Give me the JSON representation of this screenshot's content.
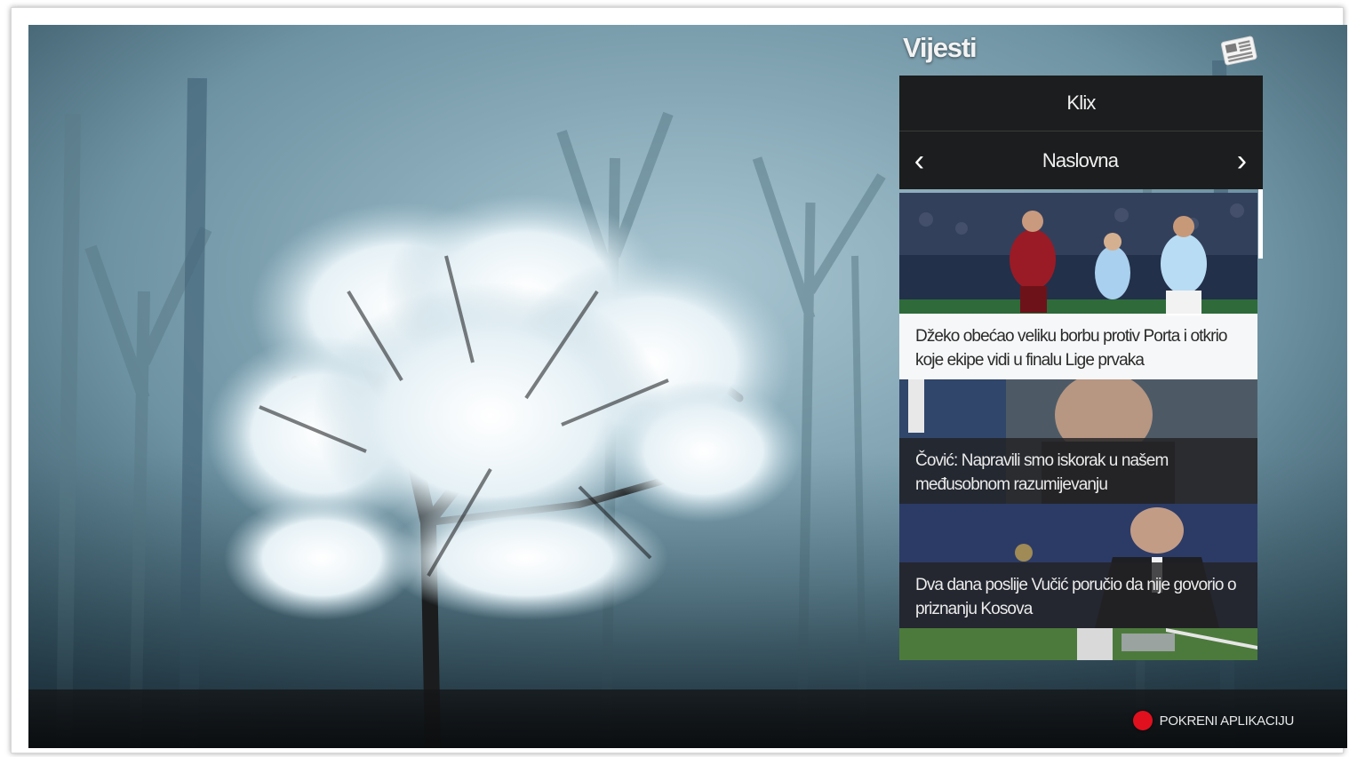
{
  "widget": {
    "title": "Vijesti",
    "icon": "newspaper-icon",
    "source": "Klix",
    "category": "Naslovna",
    "prev_icon": "chevron-left-icon",
    "next_icon": "chevron-right-icon"
  },
  "articles": [
    {
      "headline": "Džeko obećao veliku borbu protiv Porta i otkrio koje ekipe vidi u finalu Lige prvaka",
      "style": "light"
    },
    {
      "headline": "Čović: Napravili smo iskorak u našem međusobnom razumijevanju",
      "style": "dark"
    },
    {
      "headline": "Dva dana poslije Vučić poručio da nije govorio o priznanju Kosova",
      "style": "dark"
    }
  ],
  "footer": {
    "launch_label": "POKRENI APLIKACIJU",
    "launch_color": "#e0101e"
  }
}
